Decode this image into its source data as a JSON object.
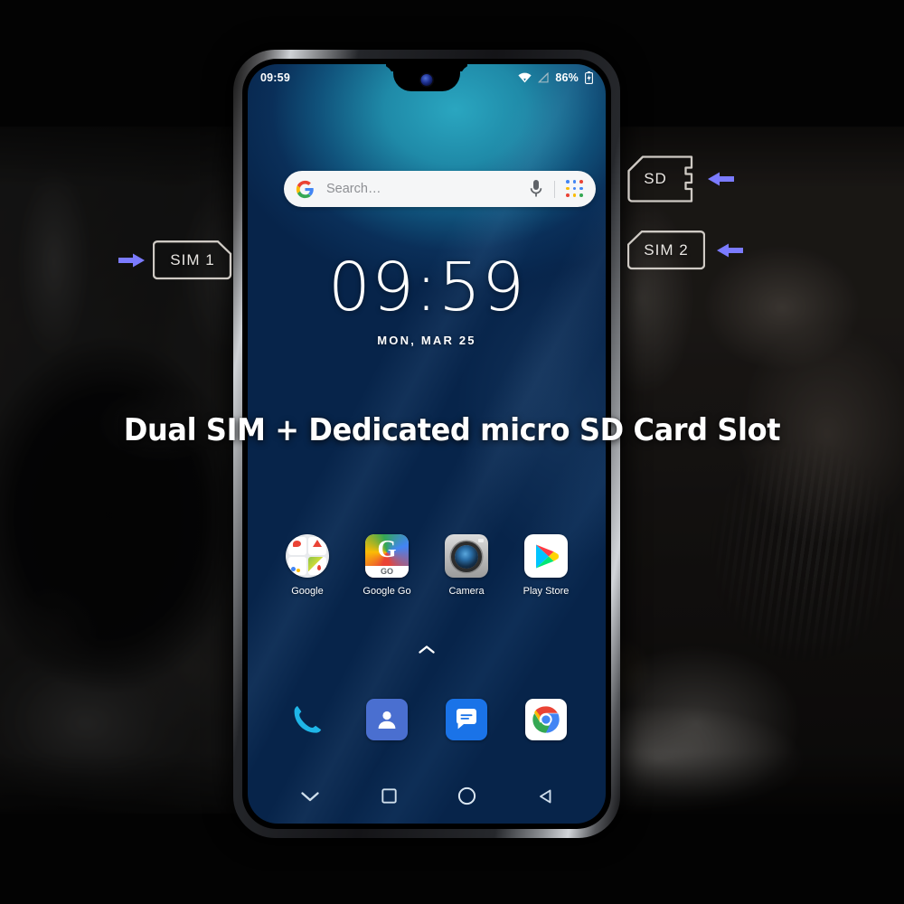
{
  "headline": "Dual SIM + Dedicated micro SD Card Slot",
  "phone": {
    "status_bar": {
      "time": "09:59",
      "battery_percent": "86%",
      "icons": [
        "wifi-icon",
        "signal-off-icon",
        "battery-icon"
      ]
    },
    "search": {
      "placeholder": "Search…",
      "google_logo": "google-g-icon",
      "mic": "microphone-icon",
      "lens": "apps-grid-icon"
    },
    "clock": {
      "time": "09:59",
      "date": "MON, MAR 25"
    },
    "apps": [
      {
        "label": "Google",
        "icon": "google-folder-icon"
      },
      {
        "label": "Google Go",
        "icon": "google-go-icon",
        "badge": "GO",
        "letter": "G"
      },
      {
        "label": "Camera",
        "icon": "camera-icon"
      },
      {
        "label": "Play Store",
        "icon": "play-store-icon"
      }
    ],
    "drawer_handle": "chevron-up-icon",
    "dock": [
      {
        "name": "phone-icon"
      },
      {
        "name": "contacts-icon"
      },
      {
        "name": "messages-icon"
      },
      {
        "name": "chrome-icon"
      }
    ],
    "navbar": [
      {
        "name": "hide-keyboard-icon"
      },
      {
        "name": "recents-square-icon"
      },
      {
        "name": "home-circle-icon"
      },
      {
        "name": "back-triangle-icon"
      }
    ]
  },
  "callouts": [
    {
      "label": "SIM 1",
      "shape": "sim-card",
      "arrow": "right"
    },
    {
      "label": "SD",
      "shape": "sd-card",
      "arrow": "left"
    },
    {
      "label": "SIM 2",
      "shape": "sim-card-left",
      "arrow": "left"
    }
  ],
  "colors": {
    "arrow": "#7b7bff",
    "callout_stroke": "#cfcac4",
    "headline": "#ffffff",
    "screen_top": "#2aa6c0",
    "screen_mid": "#0a1f42",
    "screen_bottom": "#1786ad"
  }
}
